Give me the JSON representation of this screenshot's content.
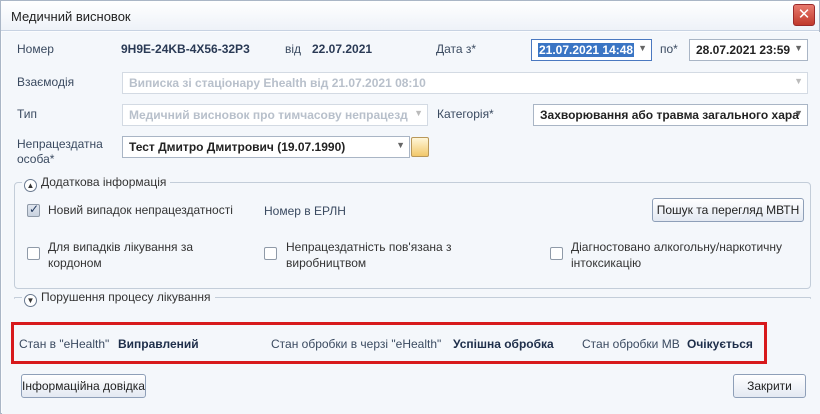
{
  "window": {
    "title": "Медичний висновок",
    "close_icon": "close-icon",
    "accent": "#d7191c"
  },
  "header": {
    "number_label": "Номер",
    "number_value": "9H9E-24KB-4X56-32P3",
    "from_label": "від",
    "from_value": "22.07.2021",
    "date_from_label": "Дата з*",
    "date_from_value": "21.07.2021 14:48",
    "date_to_label": "по*",
    "date_to_value": "28.07.2021 23:59"
  },
  "interaction": {
    "label": "Взаємодія",
    "value": "Виписка зі стаціонару Ehealth від 21.07.2021 08:10"
  },
  "type": {
    "label": "Тип",
    "value": "Медичний висновок про тимчасову непрацезд",
    "category_label": "Категорія*",
    "category_value": "Захворювання або травма загального хара"
  },
  "person": {
    "label_line1": "Непрацездатна",
    "label_line2": "особа*",
    "value": "Тест Дмитро Дмитрович (19.07.1990)"
  },
  "additional": {
    "title": "Додаткова інформація",
    "new_case_label": "Новий випадок непрацездатності",
    "new_case_checked": true,
    "erln_label": "Номер в ЕРЛН",
    "search_button": "Пошук та перегляд МВТН",
    "abroad_label": "Для випадків лікування за кордоном",
    "abroad_checked": false,
    "production_label": "Непрацездатність пов'язана з виробництвом",
    "production_checked": false,
    "alcohol_label": "Діагностовано алкогольну/наркотичну інтоксикацію",
    "alcohol_checked": false
  },
  "violation": {
    "title": "Порушення процесу лікування"
  },
  "status": {
    "ehealth_label": "Стан в \"eHealth\"",
    "ehealth_value": "Виправлений",
    "queue_label": "Стан обробки в черзі \"eHealth\"",
    "queue_value": "Успішна обробка",
    "mv_label": "Стан обробки МВ",
    "mv_value": "Очікується"
  },
  "footer": {
    "info_button": "Інформаційна довідка",
    "close_button": "Закрити"
  }
}
